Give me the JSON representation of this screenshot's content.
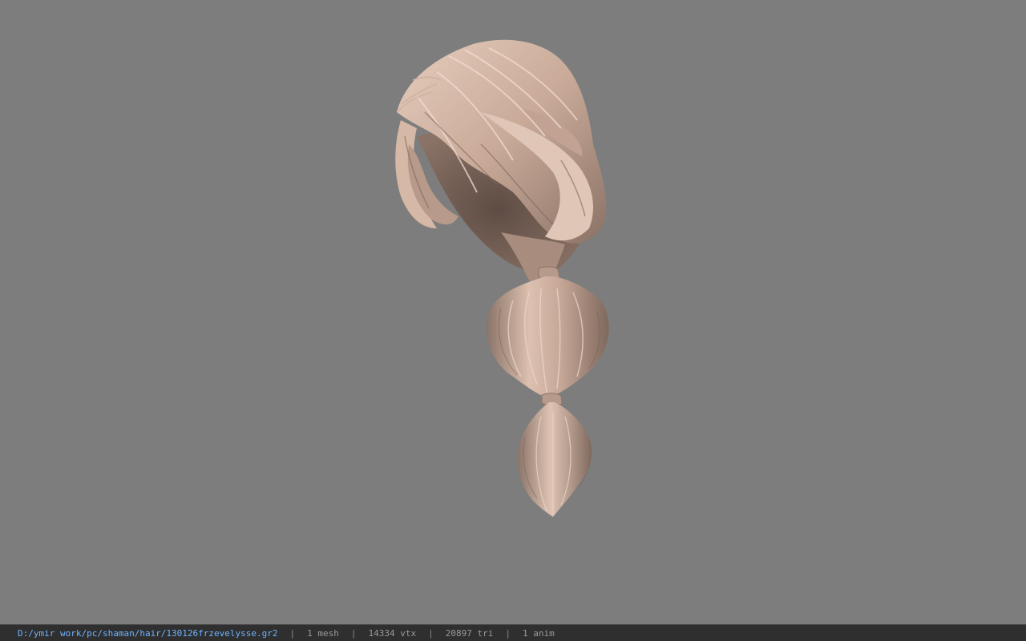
{
  "viewport": {
    "background": "#7d7d7d",
    "model": {
      "icon": "hair-mesh-icon",
      "base_color": "#c9aa98",
      "highlight_color": "#e8d0c2",
      "shadow_color": "#6e5a50"
    }
  },
  "statusbar": {
    "file_path": "D:/ymir work/pc/shaman/hair/130126frzevelysse.gr2",
    "separator": "|",
    "mesh_count": "1 mesh",
    "vertex_count": "14334 vtx",
    "triangle_count": "20897 tri",
    "anim_count": "1 anim",
    "path_color": "#6fb3ff"
  }
}
